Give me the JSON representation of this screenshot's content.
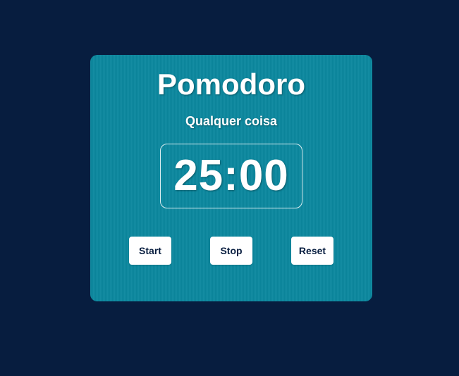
{
  "app": {
    "title": "Pomodoro",
    "subtitle": "Qualquer coisa"
  },
  "timer": {
    "display": "25:00"
  },
  "controls": {
    "start_label": "Start",
    "stop_label": "Stop",
    "reset_label": "Reset"
  },
  "colors": {
    "background": "#071d3f",
    "card": "#0b889f",
    "text": "#ffffff",
    "button": "#ffffff",
    "button_text": "#071d3f"
  }
}
